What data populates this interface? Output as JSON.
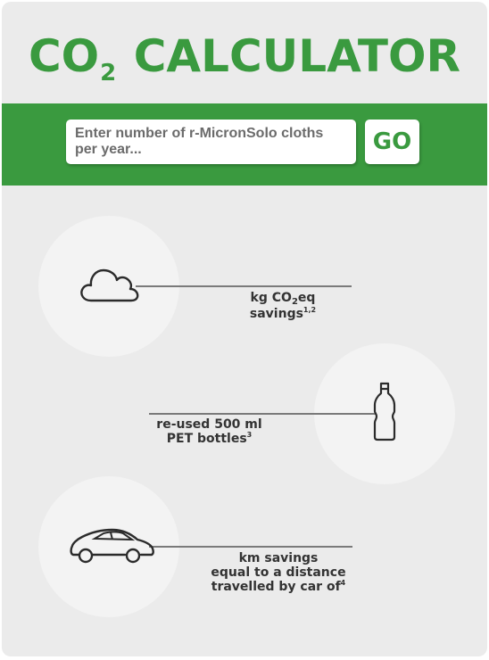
{
  "title": {
    "prefix": "CO",
    "subscript": "2",
    "suffix": "CALCULATOR"
  },
  "input": {
    "placeholder": "Enter number of r-MicronSolo cloths per year...",
    "value": ""
  },
  "go_label": "GO",
  "results": [
    {
      "icon": "cloud-icon",
      "line1_a": "kg CO",
      "line1_sub": "2",
      "line1_b": "eq",
      "line2": "savings",
      "sup": "1,2"
    },
    {
      "icon": "bottle-icon",
      "line1": "re-used 500 ml",
      "line2": "PET bottles",
      "sup": "3"
    },
    {
      "icon": "car-icon",
      "line1": "km savings",
      "line2": "equal to a distance",
      "line3": "travelled by car of",
      "sup": "4"
    }
  ],
  "colors": {
    "accent": "#3a9a3f",
    "card": "#ebebeb",
    "circle": "#f3f3f3",
    "text": "#333333"
  }
}
